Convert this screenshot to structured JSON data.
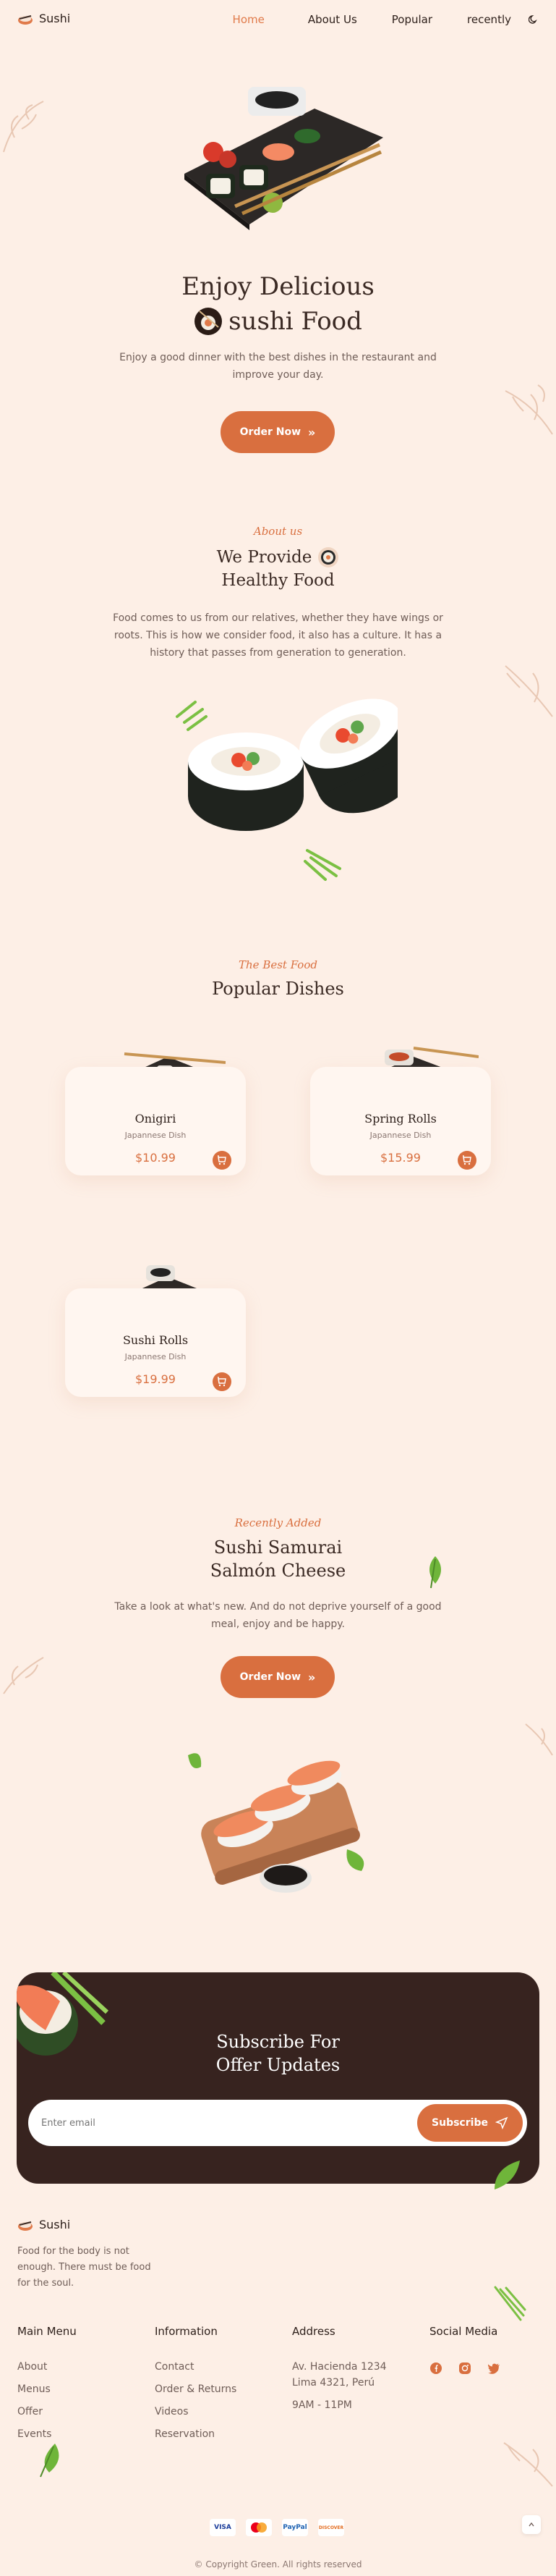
{
  "header": {
    "logo_text": "Sushi",
    "nav": [
      {
        "label": "Home",
        "active": true
      },
      {
        "label": "About Us",
        "active": false
      },
      {
        "label": "Popular",
        "active": false
      },
      {
        "label": "recently",
        "active": false
      }
    ],
    "theme_icon": "moon-icon"
  },
  "hero": {
    "title_line1": "Enjoy Delicious",
    "title_line2": "sushi Food",
    "description": "Enjoy a good dinner with the best dishes in the restaurant and improve your day.",
    "button_label": "Order Now"
  },
  "about": {
    "subtitle": "About us",
    "title_line1": "We Provide",
    "title_line2": "Healthy Food",
    "description": "Food comes to us from our relatives, whether they have wings or roots. This is how we consider food, it also has a culture. It has a history that passes from generation to generation."
  },
  "popular": {
    "subtitle": "The Best Food",
    "title": "Popular Dishes",
    "dishes": [
      {
        "name": "Onigiri",
        "desc": "Japannese Dish",
        "price": "$10.99"
      },
      {
        "name": "Spring Rolls",
        "desc": "Japannese Dish",
        "price": "$15.99"
      },
      {
        "name": "Sushi Rolls",
        "desc": "Japannese Dish",
        "price": "$19.99"
      }
    ]
  },
  "recently": {
    "subtitle": "Recently Added",
    "title_line1": "Sushi Samurai",
    "title_line2": "Salmón Cheese",
    "description": "Take a look at what's new. And do not deprive yourself of a good meal, enjoy and be happy.",
    "button_label": "Order Now"
  },
  "subscribe": {
    "title_line1": "Subscribe For",
    "title_line2": "Offer Updates",
    "placeholder": "Enter email",
    "button_label": "Subscribe"
  },
  "footer": {
    "logo_text": "Sushi",
    "tagline": "Food for the body is not enough. There must be food for the soul.",
    "main_menu": {
      "title": "Main Menu",
      "links": [
        "About",
        "Menus",
        "Offer",
        "Events"
      ]
    },
    "information": {
      "title": "Information",
      "links": [
        "Contact",
        "Order & Returns",
        "Videos",
        "Reservation"
      ]
    },
    "address": {
      "title": "Address",
      "line1": "Av. Hacienda 1234",
      "line2": "Lima 4321, Perú",
      "hours": "9AM - 11PM"
    },
    "social": {
      "title": "Social Media",
      "icons": [
        "facebook-icon",
        "instagram-icon",
        "twitter-icon"
      ]
    },
    "payments": [
      "VISA",
      "mastercard",
      "PayPal",
      "DISCOVER"
    ],
    "copyright": "© Copyright Green. All rights reserved"
  },
  "colors": {
    "accent": "#d96f3f",
    "background": "#fdefe6",
    "dark": "#37231f"
  }
}
